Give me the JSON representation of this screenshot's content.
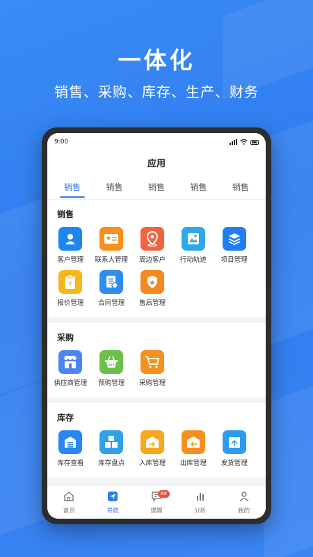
{
  "hero": {
    "title": "一体化",
    "subtitle": "销售、采购、库存、生产、财务"
  },
  "status_bar": {
    "time": "9:00"
  },
  "app": {
    "title": "应用"
  },
  "tabs": [
    {
      "label": "销售",
      "active": true
    },
    {
      "label": "销售",
      "active": false
    },
    {
      "label": "销售",
      "active": false
    },
    {
      "label": "销售",
      "active": false
    },
    {
      "label": "销售",
      "active": false
    }
  ],
  "sections": [
    {
      "title": "销售",
      "items": [
        {
          "label": "客户管理",
          "icon": "person-icon",
          "color": "#1f86f0"
        },
        {
          "label": "联系人管理",
          "icon": "contact-card-icon",
          "color": "#f5901f"
        },
        {
          "label": "周边客户",
          "icon": "location-pin-icon",
          "color": "#f26440"
        },
        {
          "label": "行动轨迹",
          "icon": "map-icon",
          "color": "#2ea8e8"
        },
        {
          "label": "项目管理",
          "icon": "layers-icon",
          "color": "#1f7ff0"
        },
        {
          "label": "报价管理",
          "icon": "quote-clipboard-icon",
          "color": "#f7b61d"
        },
        {
          "label": "合同管理",
          "icon": "contract-icon",
          "color": "#2d8cf0"
        },
        {
          "label": "售后管理",
          "icon": "shield-icon",
          "color": "#f5891f"
        }
      ]
    },
    {
      "title": "采购",
      "items": [
        {
          "label": "供应商管理",
          "icon": "store-icon",
          "color": "#4d86f2"
        },
        {
          "label": "预购管理",
          "icon": "basket-icon",
          "color": "#6cc04a"
        },
        {
          "label": "采购管理",
          "icon": "cart-icon",
          "color": "#f5911f"
        }
      ]
    },
    {
      "title": "库存",
      "items": [
        {
          "label": "库存查看",
          "icon": "warehouse-icon",
          "color": "#2a86f0"
        },
        {
          "label": "库存盘点",
          "icon": "boxes-icon",
          "color": "#2ea3e8"
        },
        {
          "label": "入库管理",
          "icon": "inbound-icon",
          "color": "#f7a81d"
        },
        {
          "label": "出库管理",
          "icon": "outbound-icon",
          "color": "#f5901f"
        },
        {
          "label": "发货管理",
          "icon": "shipping-icon",
          "color": "#2d9cf0"
        }
      ]
    }
  ],
  "tabbar": [
    {
      "label": "首页",
      "icon": "home-icon",
      "active": false
    },
    {
      "label": "导航",
      "icon": "navigation-icon",
      "active": true
    },
    {
      "label": "提醒",
      "icon": "message-icon",
      "active": false,
      "badge": "68"
    },
    {
      "label": "分析",
      "icon": "bar-chart-icon",
      "active": false
    },
    {
      "label": "我的",
      "icon": "user-icon",
      "active": false
    }
  ]
}
